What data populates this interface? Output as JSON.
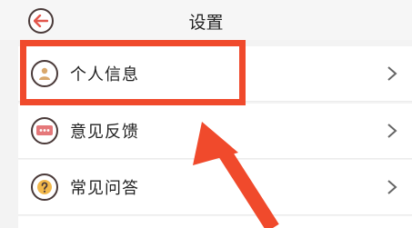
{
  "header": {
    "title": "设置"
  },
  "rows": [
    {
      "label": "个人信息",
      "icon": "person-icon"
    },
    {
      "label": "意见反馈",
      "icon": "feedback-icon"
    },
    {
      "label": "常见问答",
      "icon": "question-icon"
    }
  ],
  "colors": {
    "annotation": "#f04a2c",
    "icon_stroke": "#4a3a39",
    "back_arrow": "#e2574c"
  }
}
